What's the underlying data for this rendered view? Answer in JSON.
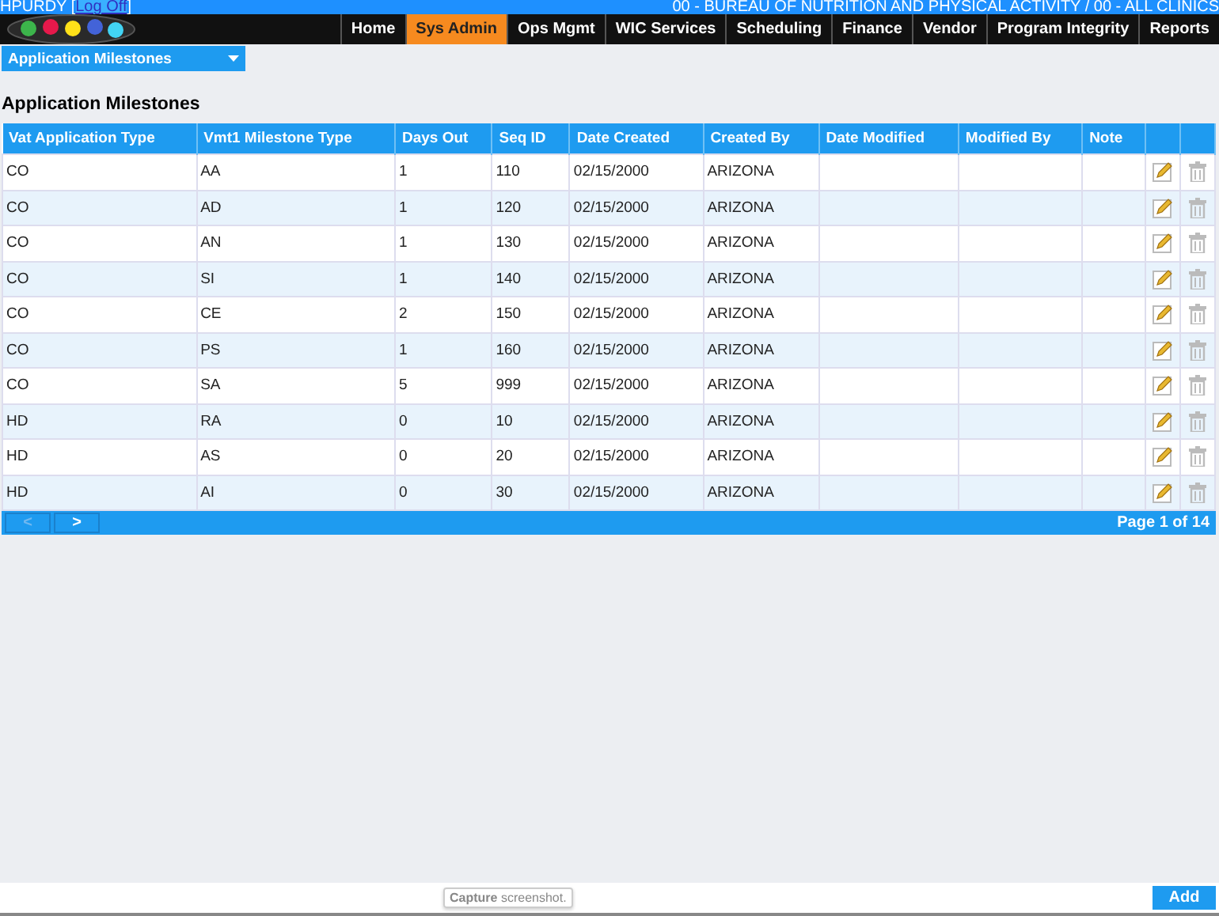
{
  "header": {
    "user": "HPURDY",
    "bracket_open": "[",
    "logoff": "Log Off",
    "bracket_close": "]",
    "agency": "00 - BUREAU OF NUTRITION AND PHYSICAL ACTIVITY / 00 - ALL CLINICS"
  },
  "nav": [
    {
      "label": "Home",
      "selected": false
    },
    {
      "label": "Sys Admin",
      "selected": true
    },
    {
      "label": "Ops Mgmt",
      "selected": false
    },
    {
      "label": "WIC Services",
      "selected": false
    },
    {
      "label": "Scheduling",
      "selected": false
    },
    {
      "label": "Finance",
      "selected": false
    },
    {
      "label": "Vendor",
      "selected": false
    },
    {
      "label": "Program Integrity",
      "selected": false
    },
    {
      "label": "Reports",
      "selected": false
    }
  ],
  "page_select": "Application Milestones",
  "title": "Application Milestones",
  "table": {
    "columns": [
      "Vat Application Type",
      "Vmt1 Milestone Type",
      "Days Out",
      "Seq ID",
      "Date Created",
      "Created By",
      "Date Modified",
      "Modified By",
      "Note"
    ],
    "rows": [
      [
        "CO",
        "AA",
        "1",
        "110",
        "02/15/2000",
        "ARIZONA",
        "",
        "",
        ""
      ],
      [
        "CO",
        "AD",
        "1",
        "120",
        "02/15/2000",
        "ARIZONA",
        "",
        "",
        ""
      ],
      [
        "CO",
        "AN",
        "1",
        "130",
        "02/15/2000",
        "ARIZONA",
        "",
        "",
        ""
      ],
      [
        "CO",
        "SI",
        "1",
        "140",
        "02/15/2000",
        "ARIZONA",
        "",
        "",
        ""
      ],
      [
        "CO",
        "CE",
        "2",
        "150",
        "02/15/2000",
        "ARIZONA",
        "",
        "",
        ""
      ],
      [
        "CO",
        "PS",
        "1",
        "160",
        "02/15/2000",
        "ARIZONA",
        "",
        "",
        ""
      ],
      [
        "CO",
        "SA",
        "5",
        "999",
        "02/15/2000",
        "ARIZONA",
        "",
        "",
        ""
      ],
      [
        "HD",
        "RA",
        "0",
        "10",
        "02/15/2000",
        "ARIZONA",
        "",
        "",
        ""
      ],
      [
        "HD",
        "AS",
        "0",
        "20",
        "02/15/2000",
        "ARIZONA",
        "",
        "",
        ""
      ],
      [
        "HD",
        "AI",
        "0",
        "30",
        "02/15/2000",
        "ARIZONA",
        "",
        "",
        ""
      ]
    ]
  },
  "pager": {
    "prev": "<",
    "next": ">",
    "prev_disabled": true,
    "page": "Page 1 of 14"
  },
  "tooltip": "**Capture** screenshot.",
  "add_button": "Add"
}
